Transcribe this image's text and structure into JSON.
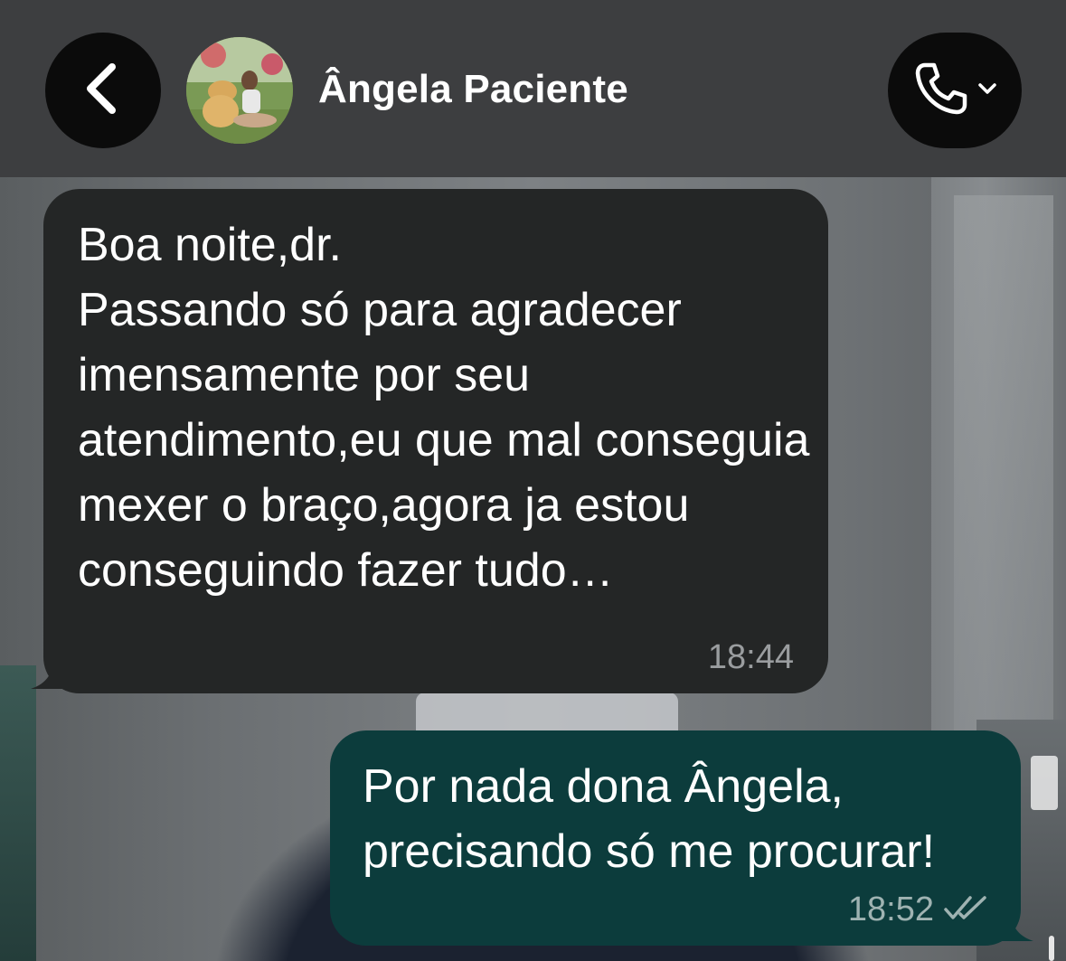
{
  "header": {
    "back_icon": "chevron-left-icon",
    "contact_name": "Ângela Paciente",
    "call_icon": "phone-icon",
    "call_dropdown_icon": "chevron-down-icon"
  },
  "messages": [
    {
      "direction": "incoming",
      "text": "Boa noite,dr.\nPassando só para agradecer imensamente por seu atendimento,eu que mal conseguia mexer o braço,agora ja estou conseguindo fazer tudo…",
      "time": "18:44"
    },
    {
      "direction": "outgoing",
      "text": "Por nada dona Ângela,\nprecisando só me procurar!",
      "time": "18:52",
      "status_icon": "read-double-check-icon"
    }
  ],
  "colors": {
    "header_bg": "#3d3e40",
    "incoming_bubble": "#242626",
    "outgoing_bubble": "#0c3c3c",
    "button_bg": "#0b0b0b"
  }
}
